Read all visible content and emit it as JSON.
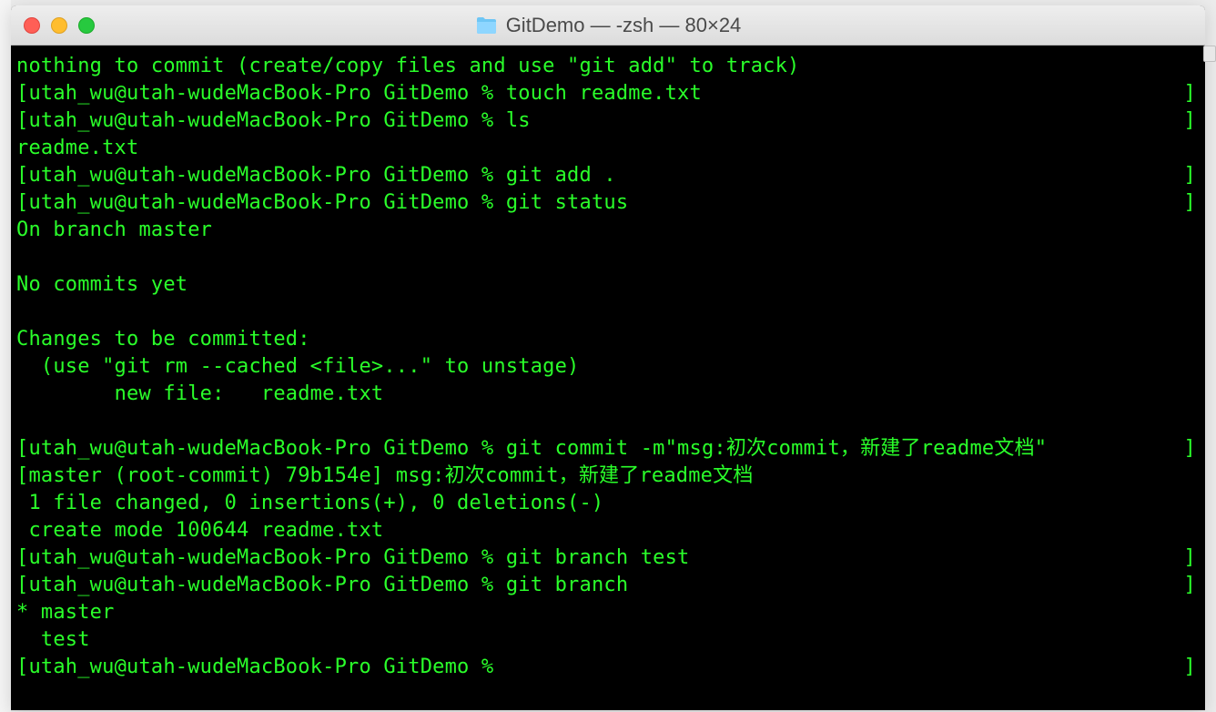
{
  "window": {
    "title": "GitDemo — -zsh — 80×24"
  },
  "terminal": {
    "lines": [
      {
        "type": "plain",
        "text": "nothing to commit (create/copy files and use \"git add\" to track)"
      },
      {
        "type": "prompt",
        "prompt": "utah_wu@utah-wudeMacBook-Pro GitDemo % ",
        "cmd": "touch readme.txt"
      },
      {
        "type": "prompt",
        "prompt": "utah_wu@utah-wudeMacBook-Pro GitDemo % ",
        "cmd": "ls"
      },
      {
        "type": "plain",
        "text": "readme.txt"
      },
      {
        "type": "prompt",
        "prompt": "utah_wu@utah-wudeMacBook-Pro GitDemo % ",
        "cmd": "git add ."
      },
      {
        "type": "prompt",
        "prompt": "utah_wu@utah-wudeMacBook-Pro GitDemo % ",
        "cmd": "git status"
      },
      {
        "type": "plain",
        "text": "On branch master"
      },
      {
        "type": "plain",
        "text": ""
      },
      {
        "type": "plain",
        "text": "No commits yet"
      },
      {
        "type": "plain",
        "text": ""
      },
      {
        "type": "plain",
        "text": "Changes to be committed:"
      },
      {
        "type": "plain",
        "text": "  (use \"git rm --cached <file>...\" to unstage)"
      },
      {
        "type": "plain",
        "text": "        new file:   readme.txt"
      },
      {
        "type": "plain",
        "text": ""
      },
      {
        "type": "prompt",
        "prompt": "utah_wu@utah-wudeMacBook-Pro GitDemo % ",
        "cmd": "git commit -m\"msg:初次commit，新建了readme文档\""
      },
      {
        "type": "plain",
        "text": "[master (root-commit) 79b154e] msg:初次commit，新建了readme文档"
      },
      {
        "type": "plain",
        "text": " 1 file changed, 0 insertions(+), 0 deletions(-)"
      },
      {
        "type": "plain",
        "text": " create mode 100644 readme.txt"
      },
      {
        "type": "prompt",
        "prompt": "utah_wu@utah-wudeMacBook-Pro GitDemo % ",
        "cmd": "git branch test"
      },
      {
        "type": "prompt",
        "prompt": "utah_wu@utah-wudeMacBook-Pro GitDemo % ",
        "cmd": "git branch"
      },
      {
        "type": "plain",
        "text": "* master"
      },
      {
        "type": "plain",
        "text": "  test"
      },
      {
        "type": "prompt",
        "prompt": "utah_wu@utah-wudeMacBook-Pro GitDemo % ",
        "cmd": ""
      }
    ]
  }
}
